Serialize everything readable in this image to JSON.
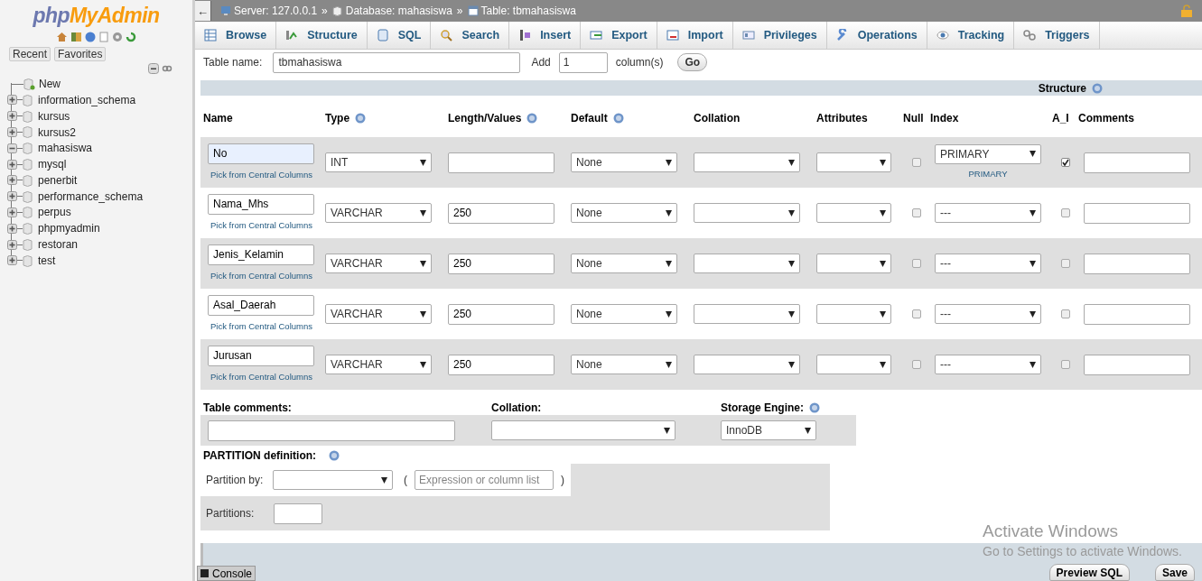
{
  "sidebar": {
    "logo": {
      "part_1": "php",
      "part_2": "MyAdmin"
    },
    "tabs": [
      "Recent",
      "Favorites"
    ],
    "new_item": "New",
    "databases": [
      {
        "name": "information_schema",
        "expanded": false
      },
      {
        "name": "kursus",
        "expanded": false
      },
      {
        "name": "kursus2",
        "expanded": false
      },
      {
        "name": "mahasiswa",
        "expanded": true
      },
      {
        "name": "mysql",
        "expanded": false
      },
      {
        "name": "penerbit",
        "expanded": false
      },
      {
        "name": "performance_schema",
        "expanded": false
      },
      {
        "name": "perpus",
        "expanded": false
      },
      {
        "name": "phpmyadmin",
        "expanded": false
      },
      {
        "name": "restoran",
        "expanded": false
      },
      {
        "name": "test",
        "expanded": false
      }
    ]
  },
  "breadcrumb": {
    "back": "←",
    "separator": "»",
    "items": [
      {
        "kind": "server",
        "label": "Server: 127.0.0.1"
      },
      {
        "kind": "database",
        "label": "Database: mahasiswa"
      },
      {
        "kind": "table",
        "label": "Table: tbmahasiswa"
      }
    ]
  },
  "tabs": [
    {
      "kind": "browse",
      "label": "Browse"
    },
    {
      "kind": "structure",
      "label": "Structure"
    },
    {
      "kind": "sql",
      "label": "SQL"
    },
    {
      "kind": "search",
      "label": "Search"
    },
    {
      "kind": "insert",
      "label": "Insert"
    },
    {
      "kind": "export",
      "label": "Export"
    },
    {
      "kind": "import",
      "label": "Import"
    },
    {
      "kind": "privileges",
      "label": "Privileges"
    },
    {
      "kind": "operations",
      "label": "Operations"
    },
    {
      "kind": "tracking",
      "label": "Tracking"
    },
    {
      "kind": "triggers",
      "label": "Triggers"
    }
  ],
  "table_name_row": {
    "label": "Table name:",
    "value": "tbmahasiswa",
    "add_label": "Add",
    "add_value": "1",
    "columns_label": "column(s)",
    "go": "Go"
  },
  "structure_label": "Structure",
  "columns": [
    {
      "label": "Name",
      "help": false
    },
    {
      "label": "Type",
      "help": true
    },
    {
      "label": "Length/Values",
      "help": true
    },
    {
      "label": "Default",
      "help": true
    },
    {
      "label": "Collation",
      "help": false
    },
    {
      "label": "Attributes",
      "help": false
    },
    {
      "label": "Null",
      "help": false
    },
    {
      "label": "Index",
      "help": false
    },
    {
      "label": "A_I",
      "help": false
    },
    {
      "label": "Comments",
      "help": false
    }
  ],
  "rows": [
    {
      "name": "No",
      "focused": true,
      "pick": "Pick from Central Columns",
      "type": "INT",
      "length": "",
      "default": "None",
      "null": false,
      "index": "PRIMARY",
      "index_note": "PRIMARY",
      "ai": true
    },
    {
      "name": "Nama_Mhs",
      "focused": false,
      "pick": "Pick from Central Columns",
      "type": "VARCHAR",
      "length": "250",
      "default": "None",
      "null": false,
      "index": "---",
      "ai": false
    },
    {
      "name": "Jenis_Kelamin",
      "focused": false,
      "pick": "Pick from Central Columns",
      "type": "VARCHAR",
      "length": "250",
      "default": "None",
      "null": false,
      "index": "---",
      "ai": false
    },
    {
      "name": "Asal_Daerah",
      "focused": false,
      "pick": "Pick from Central Columns",
      "type": "VARCHAR",
      "length": "250",
      "default": "None",
      "null": false,
      "index": "---",
      "ai": false
    },
    {
      "name": "Jurusan",
      "focused": false,
      "pick": "Pick from Central Columns",
      "type": "VARCHAR",
      "length": "250",
      "default": "None",
      "null": false,
      "index": "---",
      "ai": false
    }
  ],
  "table_options": {
    "comments_label": "Table comments:",
    "collation_label": "Collation:",
    "engine_label": "Storage Engine:",
    "engine_value": "InnoDB"
  },
  "partition": {
    "label": "PARTITION definition:",
    "by_label": "Partition by:",
    "open_paren": "(",
    "expression_placeholder": "Expression or column list",
    "close_paren": ")",
    "partitions_label": "Partitions:"
  },
  "console": "Console",
  "buttons": [
    "Preview SQL",
    "Save"
  ],
  "windows_notice": {
    "title": "Activate Windows",
    "text": "Go to Settings to activate Windows."
  }
}
